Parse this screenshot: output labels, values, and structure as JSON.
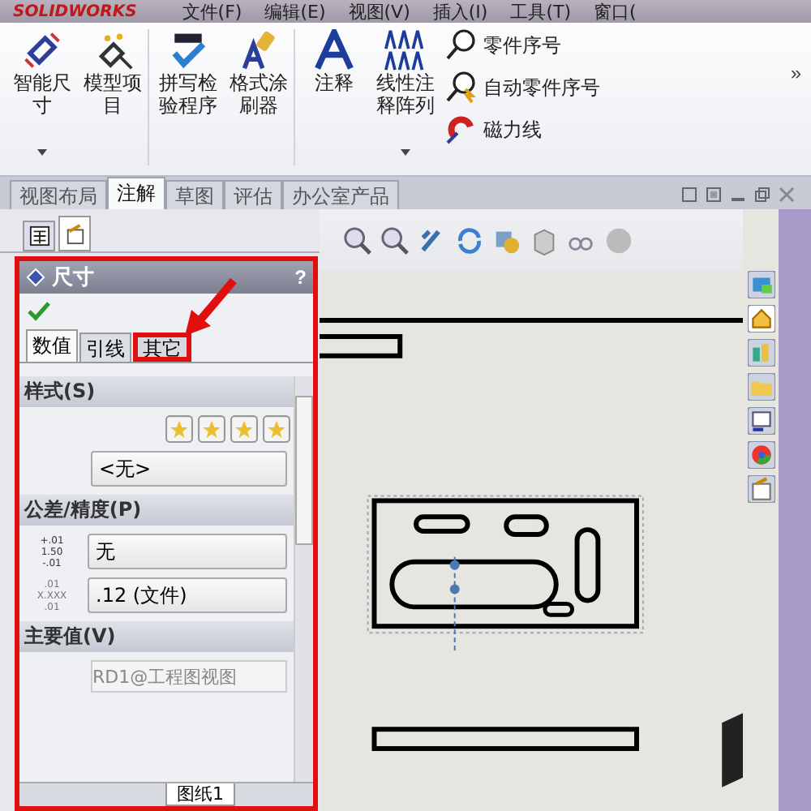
{
  "menu_bar": {
    "logo": "SOLIDWORKS",
    "items": [
      "文件(F)",
      "编辑(E)",
      "视图(V)",
      "插入(I)",
      "工具(T)",
      "窗口("
    ]
  },
  "ribbon": {
    "large_buttons": [
      {
        "kind": "smart-dimension",
        "label": "智能尺寸",
        "dropdown": true
      },
      {
        "kind": "model-items",
        "label": "模型项目",
        "dropdown": false
      },
      {
        "kind": "spell-check",
        "label": "拼写检验程序",
        "dropdown": false
      },
      {
        "kind": "format-painter",
        "label": "格式涂刷器",
        "dropdown": false
      },
      {
        "kind": "note",
        "label": "注释",
        "dropdown": false
      },
      {
        "kind": "note-pattern",
        "label": "线性注释阵列",
        "dropdown": true
      }
    ],
    "small_buttons": [
      {
        "kind": "balloon",
        "label": "零件序号"
      },
      {
        "kind": "auto-balloon",
        "label": "自动零件序号"
      },
      {
        "kind": "magnetic-line",
        "label": "磁力线"
      }
    ],
    "more": "»"
  },
  "command_tabs": [
    {
      "label": "视图布局",
      "selected": false
    },
    {
      "label": "注解",
      "selected": true
    },
    {
      "label": "草图",
      "selected": false
    },
    {
      "label": "评估",
      "selected": false
    },
    {
      "label": "办公室产品",
      "selected": false
    }
  ],
  "manager_tabs": [
    {
      "kind": "tree",
      "selected": false
    },
    {
      "kind": "property",
      "selected": true
    }
  ],
  "property_manager": {
    "title": "尺寸",
    "help": "?",
    "tabs": [
      {
        "label": "数值",
        "selected": true,
        "highlighted": false
      },
      {
        "label": "引线",
        "selected": false,
        "highlighted": false
      },
      {
        "label": "其它",
        "selected": false,
        "highlighted": true
      }
    ],
    "style": {
      "title": "样式(S)",
      "value": "<无>"
    },
    "tolerance": {
      "title": "公差/精度(P)",
      "rows": [
        {
          "kind": "tolerance",
          "icon_lines": [
            "+.01",
            "1.50",
            "-.01"
          ],
          "value": "无"
        },
        {
          "kind": "precision",
          "icon_lines": [
            ".01",
            "X.XXX",
            ".01"
          ],
          "value": ".12 (文件)"
        }
      ]
    },
    "primary_value": {
      "title": "主要值(V)",
      "value": "RD1@工程图视图",
      "disabled": true
    }
  },
  "sheet_tab": "图纸1"
}
